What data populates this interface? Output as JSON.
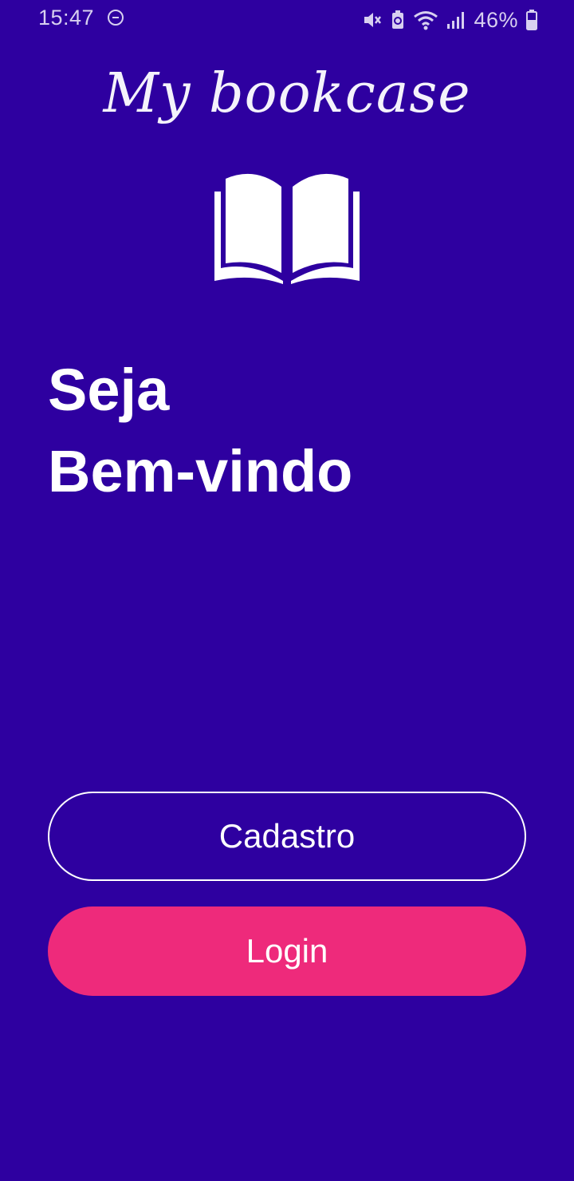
{
  "status_bar": {
    "time": "15:47",
    "battery": "46%",
    "icons": [
      "do-not-disturb-icon",
      "mute-icon",
      "battery-saver-icon",
      "wifi-icon",
      "signal-icon",
      "battery-icon"
    ]
  },
  "app": {
    "logo_title": "My bookcase",
    "logo_icon": "open-book-icon"
  },
  "welcome": {
    "line1": "Seja",
    "line2": "Bem-vindo"
  },
  "buttons": {
    "signup_label": "Cadastro",
    "login_label": "Login"
  },
  "colors": {
    "background": "#2e00a0",
    "login_button": "#ee2a7b",
    "text": "#ffffff"
  }
}
